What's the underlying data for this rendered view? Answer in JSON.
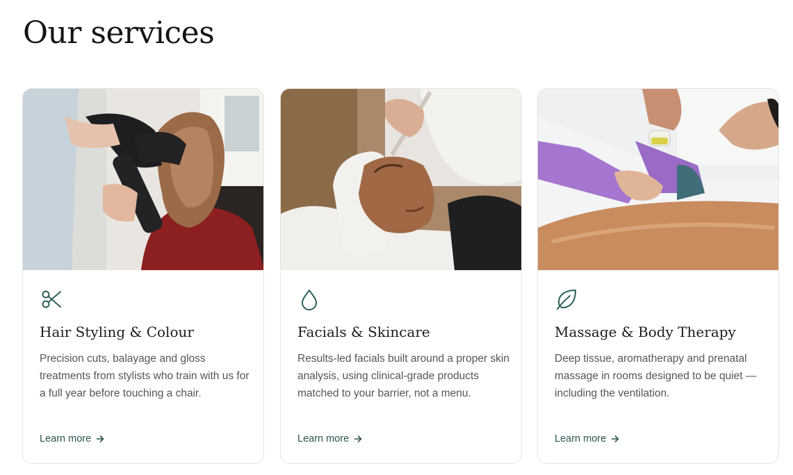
{
  "heading": "Our services",
  "accent_color": "#2b5f5a",
  "cards": [
    {
      "photo": "hair-stylist-blow-drying-photo",
      "icon": "scissors-icon",
      "title": "Hair Styling & Colour",
      "description": "Precision cuts, balayage and gloss treatments from stylists who train with us for a full year before touching a chair.",
      "link": "Learn more"
    },
    {
      "photo": "facial-mask-treatment-photo",
      "icon": "droplet-icon",
      "title": "Facials & Skincare",
      "description": "Results-led facials built around a proper skin analysis, using clinical-grade products matched to your barrier, not a menu.",
      "link": "Learn more"
    },
    {
      "photo": "oil-massage-photo",
      "icon": "leaf-icon",
      "title": "Massage & Body Therapy",
      "description": "Deep tissue, aromatherapy and prenatal massage in rooms designed to be quiet — including the ventilation.",
      "link": "Learn more"
    }
  ]
}
